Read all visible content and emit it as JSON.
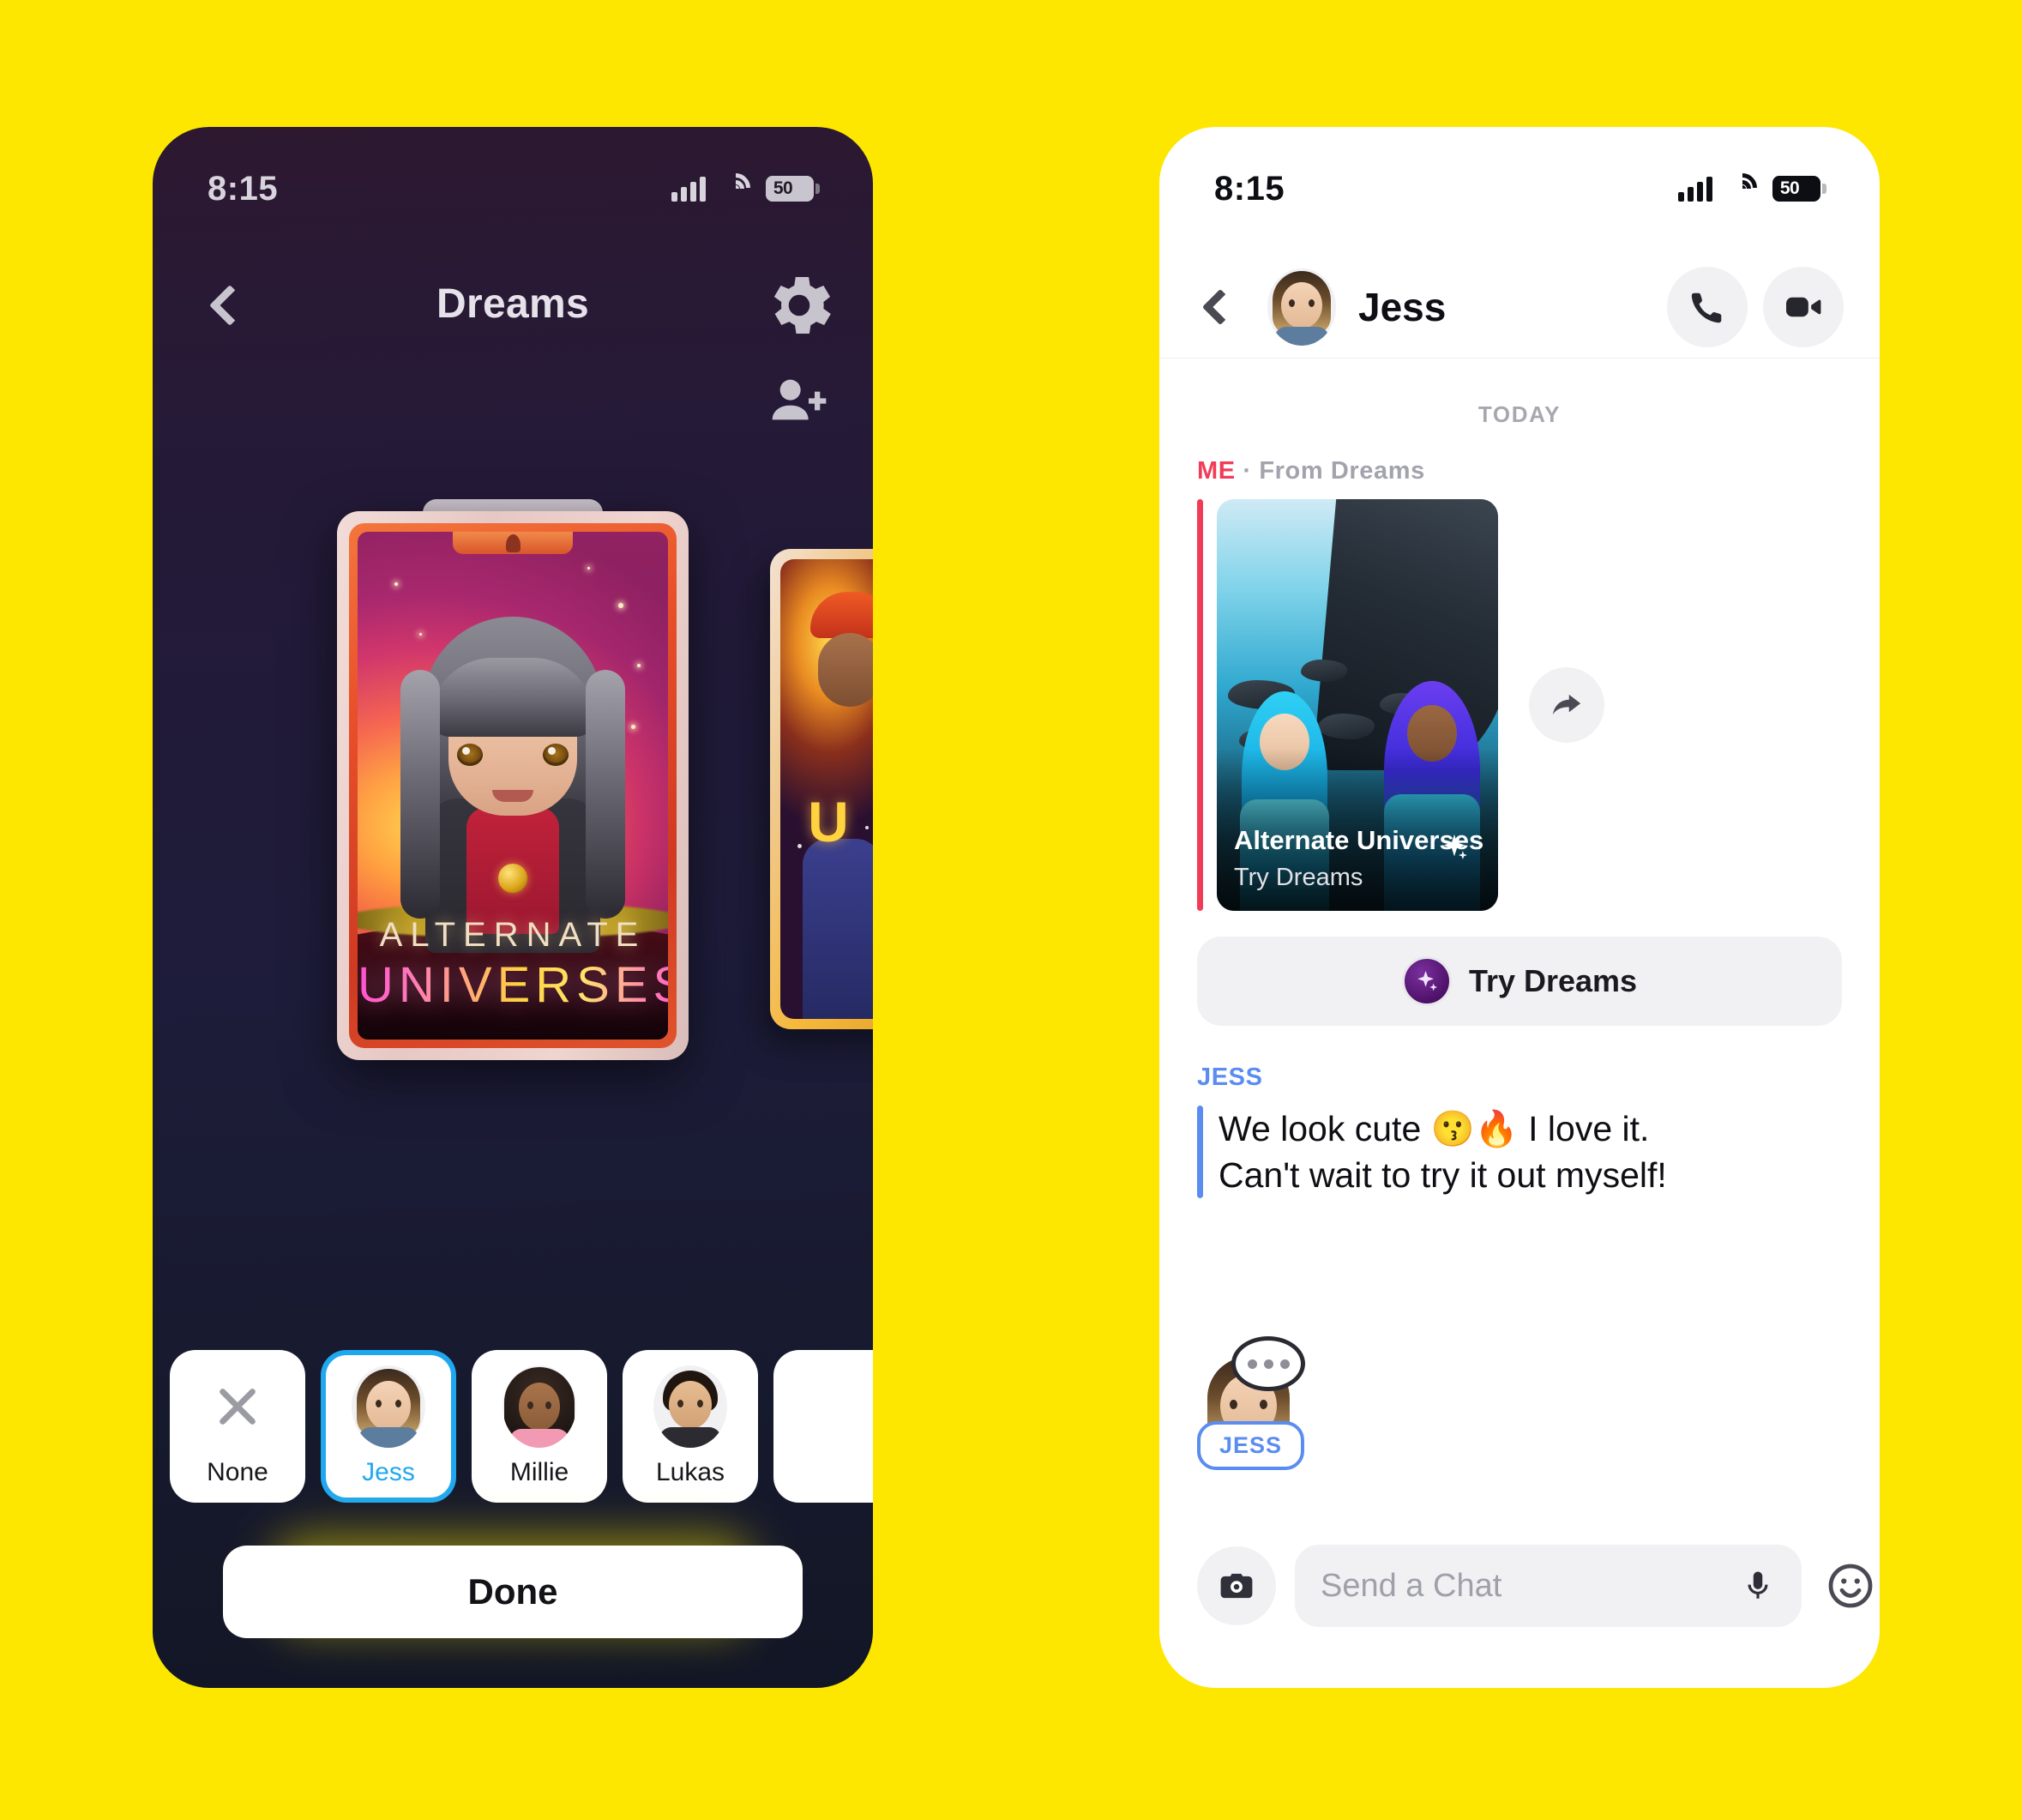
{
  "background_color": "#FDE700",
  "left_phone": {
    "status": {
      "time": "8:15",
      "battery": "50",
      "signal_icon": "cellular-bars-icon",
      "wifi_icon": "wifi-icon",
      "battery_icon": "battery-icon"
    },
    "header": {
      "title": "Dreams",
      "back_icon": "back-chevron-icon",
      "settings_icon": "gear-icon",
      "add_friend_icon": "add-person-icon"
    },
    "card": {
      "title_line1": "ALTERNATE",
      "title_line2": "UNIVERSES",
      "brand_glyph": "snapchat-ghost-icon",
      "frame_color": "#e6c8c4",
      "bezel_color": "#e8502a"
    },
    "peek_card": {
      "frame_color": "#f6b93c",
      "partial_title": "U"
    },
    "friends": {
      "items": [
        {
          "label": "None",
          "icon": "x-icon",
          "selected": false
        },
        {
          "label": "Jess",
          "icon": "bitmoji-avatar",
          "selected": true
        },
        {
          "label": "Millie",
          "icon": "bitmoji-avatar",
          "selected": false
        },
        {
          "label": "Lukas",
          "icon": "bitmoji-avatar",
          "selected": false
        }
      ],
      "selected_color": "#1FA8F0"
    },
    "done_label": "Done"
  },
  "right_phone": {
    "status": {
      "time": "8:15",
      "battery": "50",
      "signal_icon": "cellular-bars-icon",
      "wifi_icon": "wifi-icon",
      "battery_icon": "battery-icon"
    },
    "header": {
      "name": "Jess",
      "back_icon": "back-chevron-icon",
      "avatar_icon": "bitmoji-avatar",
      "call_icon": "phone-call-icon",
      "video_icon": "video-camera-icon"
    },
    "conversation": {
      "day_separator": "TODAY",
      "sent": {
        "sender": "ME",
        "separator": "·",
        "source": "From Dreams",
        "accent_color": "#F23C57",
        "media_title": "Alternate Universes",
        "media_subtitle": "Try Dreams",
        "sparkle_icon": "sparkle-icon",
        "share_icon": "share-arrow-icon"
      },
      "try_dreams": {
        "label": "Try Dreams",
        "badge_icon": "sparkle-icon",
        "badge_color": "#4e1269"
      },
      "received": {
        "sender": "JESS",
        "accent_color": "#5B8CF0",
        "line1": "We look cute 😗🔥 I love it.",
        "line2": "Can't wait to try it out myself!"
      },
      "typing_indicator": {
        "name_pill": "JESS",
        "avatar_icon": "bitmoji-avatar",
        "bubble_icon": "typing-bubble-icon"
      }
    },
    "composer": {
      "camera_icon": "camera-icon",
      "placeholder": "Send a Chat",
      "value": "",
      "mic_icon": "microphone-icon",
      "emoji_icon": "smiley-icon",
      "stickers_icon": "stickers-icon",
      "plus_icon": "plus-circle-icon"
    }
  }
}
